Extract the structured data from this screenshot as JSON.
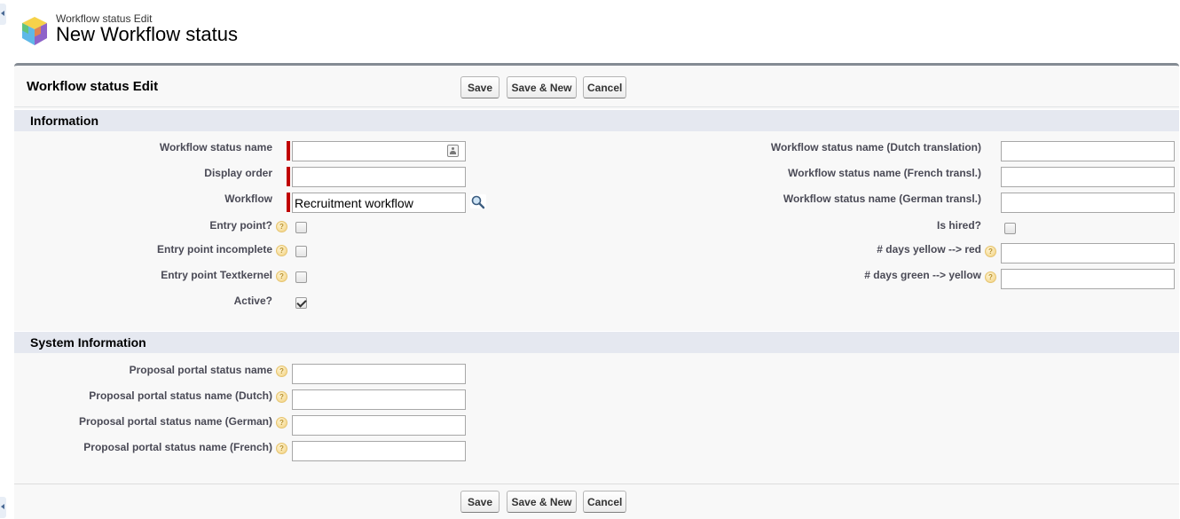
{
  "header": {
    "subtitle": "Workflow status Edit",
    "title": "New Workflow status"
  },
  "block": {
    "title": "Workflow status Edit",
    "buttons": {
      "save": "Save",
      "save_new": "Save & New",
      "cancel": "Cancel"
    }
  },
  "sections": {
    "information": "Information",
    "system": "System Information"
  },
  "information": {
    "left": {
      "workflow_status_name": {
        "label": "Workflow status name",
        "value": ""
      },
      "display_order": {
        "label": "Display order",
        "value": ""
      },
      "workflow": {
        "label": "Workflow",
        "value": "Recruitment workflow"
      },
      "entry_point": {
        "label": "Entry point?",
        "checked": false
      },
      "entry_point_incomplete": {
        "label": "Entry point incomplete",
        "checked": false
      },
      "entry_point_textkernel": {
        "label": "Entry point Textkernel",
        "checked": false
      },
      "active": {
        "label": "Active?",
        "checked": true
      }
    },
    "right": {
      "name_dutch": {
        "label": "Workflow status name (Dutch translation)",
        "value": ""
      },
      "name_french": {
        "label": "Workflow status name (French transl.)",
        "value": ""
      },
      "name_german": {
        "label": "Workflow status name (German transl.)",
        "value": ""
      },
      "is_hired": {
        "label": "Is hired?",
        "checked": false
      },
      "days_yellow_red": {
        "label": "# days yellow --> red",
        "value": ""
      },
      "days_green_yellow": {
        "label": "# days green --> yellow",
        "value": ""
      }
    }
  },
  "system": {
    "portal_name": {
      "label": "Proposal portal status name",
      "value": ""
    },
    "portal_name_dutch": {
      "label": "Proposal portal status name (Dutch)",
      "value": ""
    },
    "portal_name_german": {
      "label": "Proposal portal status name (German)",
      "value": ""
    },
    "portal_name_french": {
      "label": "Proposal portal status name (French)",
      "value": ""
    }
  },
  "icons": {
    "help": "help-icon",
    "lookup": "magnifier-lookup-icon",
    "contact": "contact-card-icon",
    "app": "cube-app-icon"
  },
  "colors": {
    "required": "#c00000",
    "section_bg": "#e5e8f0",
    "block_border": "#848b93"
  }
}
